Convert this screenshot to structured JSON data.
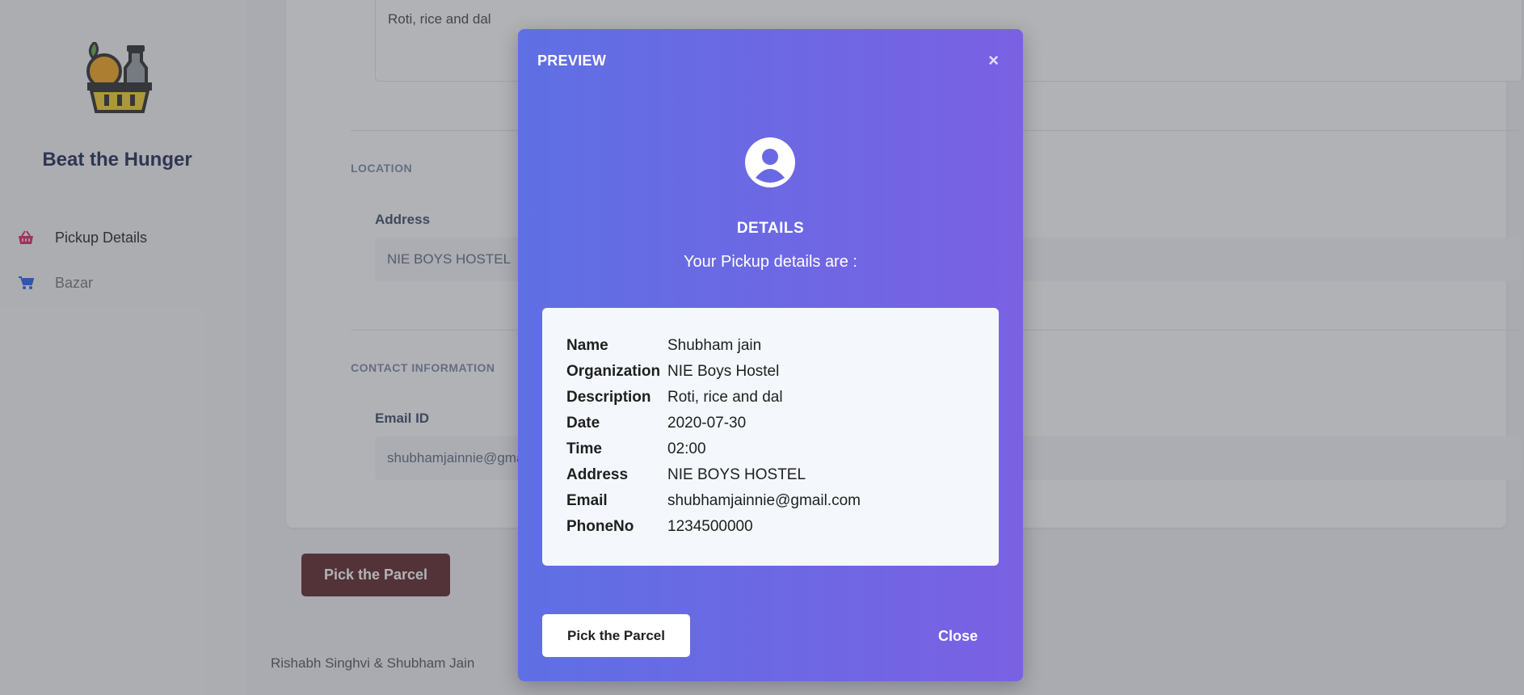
{
  "app": {
    "brand": "Beat the Hunger"
  },
  "sidebar": {
    "items": [
      {
        "label": "Pickup Details",
        "icon": "basket-icon"
      },
      {
        "label": "Bazar",
        "icon": "cart-icon"
      }
    ]
  },
  "form": {
    "description_value": "Roti, rice and dal",
    "location_title": "LOCATION",
    "address_label": "Address",
    "address_value": "NIE BOYS HOSTEL",
    "contact_title": "CONTACT INFORMATION",
    "email_label": "Email ID",
    "email_value": "shubhamjainnie@gmail.com",
    "submit_label": "Pick the Parcel"
  },
  "footer": {
    "credits": "Rishabh Singhvi & Shubham Jain"
  },
  "modal": {
    "title": "PREVIEW",
    "close_icon": "×",
    "heading": "DETAILS",
    "subheading": "Your Pickup details are :",
    "rows": [
      {
        "key": "Name",
        "value": "Shubham jain"
      },
      {
        "key": "Organization",
        "value": "NIE Boys Hostel"
      },
      {
        "key": "Description",
        "value": "Roti, rice and dal"
      },
      {
        "key": "Date",
        "value": "2020-07-30"
      },
      {
        "key": "Time",
        "value": "02:00"
      },
      {
        "key": "Address",
        "value": "NIE BOYS HOSTEL"
      },
      {
        "key": "Email",
        "value": "shubhamjainnie@gmail.com"
      },
      {
        "key": "PhoneNo",
        "value": "1234500000"
      }
    ],
    "primary_button": "Pick the Parcel",
    "secondary_button": "Close"
  },
  "colors": {
    "modal_gradient_start": "#5f6fe4",
    "modal_gradient_end": "#7a61e3",
    "submit_button": "#5e2528",
    "brand_text": "#1f2a56"
  }
}
